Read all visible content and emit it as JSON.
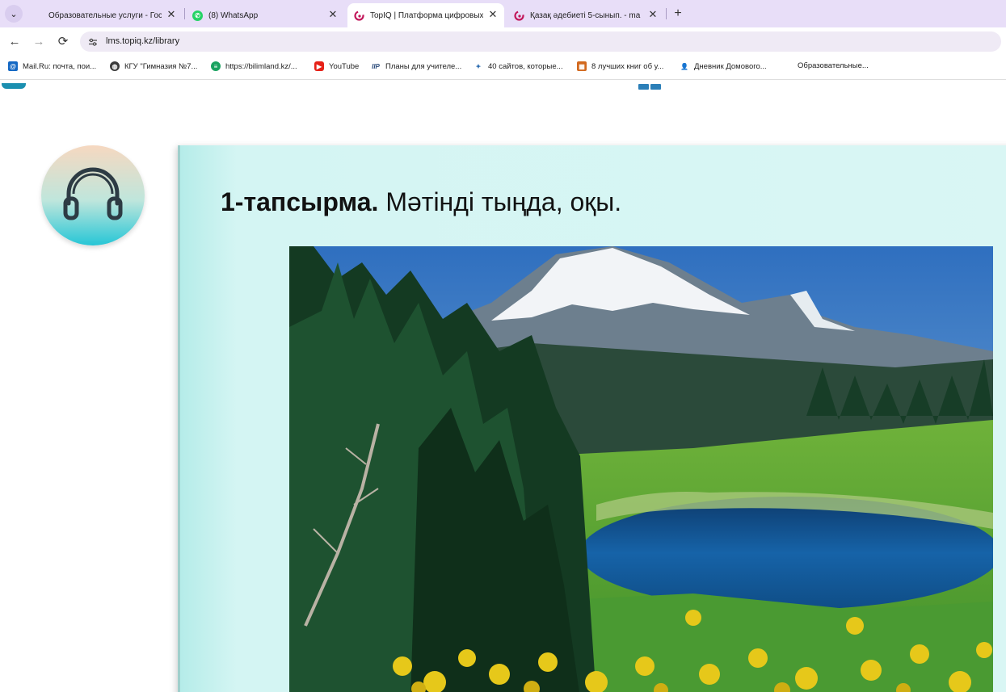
{
  "browser": {
    "tabs": [
      {
        "title": "Образовательные услуги - Гос",
        "active": false
      },
      {
        "title": "(8) WhatsApp",
        "active": false
      },
      {
        "title": "TopIQ | Платформа цифровых",
        "active": true
      },
      {
        "title": "Қазақ әдебиеті 5-сынып. - ma",
        "active": false
      }
    ],
    "url": "lms.topiq.kz/library",
    "bookmarks": [
      {
        "label": "Mail.Ru: почта, пои...",
        "icon": "mailru-icon"
      },
      {
        "label": "КГУ \"Гимназия №7...",
        "icon": "globe-icon"
      },
      {
        "label": "https://bilimland.kz/...",
        "icon": "bilimland-icon"
      },
      {
        "label": "YouTube",
        "icon": "youtube-icon"
      },
      {
        "label": "Планы для учителе...",
        "icon": "plans-icon"
      },
      {
        "label": "40 сайтов, которые...",
        "icon": "sites-icon"
      },
      {
        "label": "8 лучших книг об у...",
        "icon": "gift-icon"
      },
      {
        "label": "Дневник Домового...",
        "icon": "person-icon"
      },
      {
        "label": "Образовательные...",
        "icon": "folder-icon"
      }
    ]
  },
  "content": {
    "task_number": "1-тапсырма.",
    "task_text": " Мәтінді тыңда, оқы.",
    "audio_icon": "headphones-icon",
    "image_description": "mountain-lake-landscape"
  },
  "colors": {
    "tabstrip": "#e8def8",
    "card_bg": "#d9f6f4",
    "accent": "#26c6d6"
  }
}
